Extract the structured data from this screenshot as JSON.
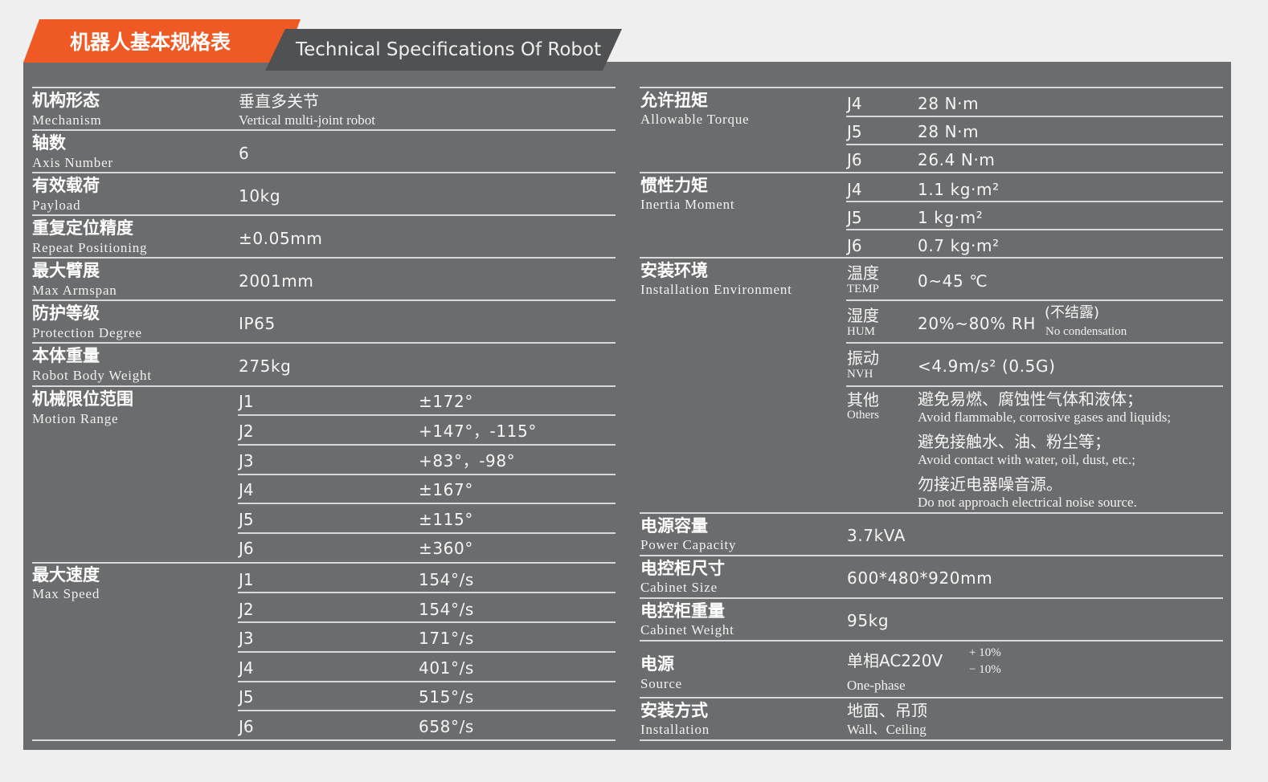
{
  "header": {
    "title_cn": "机器人基本规格表",
    "title_en": "Technical Specifications Of Robot"
  },
  "left": {
    "mechanism": {
      "cn": "机构形态",
      "en": "Mechanism",
      "value_cn": "垂直多关节",
      "value_en": "Vertical multi-joint robot"
    },
    "axis": {
      "cn": "轴数",
      "en": "Axis Number",
      "value": "6"
    },
    "payload": {
      "cn": "有效载荷",
      "en": "Payload",
      "value": "10kg"
    },
    "repeat": {
      "cn": "重复定位精度",
      "en": "Repeat Positioning",
      "value": "±0.05mm"
    },
    "armspan": {
      "cn": "最大臂展",
      "en": "Max Armspan",
      "value": "2001mm"
    },
    "protection": {
      "cn": "防护等级",
      "en": "Protection Degree",
      "value": "IP65"
    },
    "weight": {
      "cn": "本体重量",
      "en": "Robot Body Weight",
      "value": "275kg"
    },
    "motion": {
      "cn": "机械限位范围",
      "en": "Motion Range",
      "rows": [
        {
          "j": "J1",
          "v": "±172°"
        },
        {
          "j": "J2",
          "v": "+147°，-115°"
        },
        {
          "j": "J3",
          "v": "+83°，-98°"
        },
        {
          "j": "J4",
          "v": "±167°"
        },
        {
          "j": "J5",
          "v": "±115°"
        },
        {
          "j": "J6",
          "v": "±360°"
        }
      ]
    },
    "speed": {
      "cn": "最大速度",
      "en": "Max Speed",
      "rows": [
        {
          "j": "J1",
          "v": "154°/s"
        },
        {
          "j": "J2",
          "v": "154°/s"
        },
        {
          "j": "J3",
          "v": "171°/s"
        },
        {
          "j": "J4",
          "v": "401°/s"
        },
        {
          "j": "J5",
          "v": "515°/s"
        },
        {
          "j": "J6",
          "v": "658°/s"
        }
      ]
    }
  },
  "right": {
    "torque": {
      "cn": "允许扭矩",
      "en": "Allowable Torque",
      "rows": [
        {
          "j": "J4",
          "v": "28 N·m"
        },
        {
          "j": "J5",
          "v": "28 N·m"
        },
        {
          "j": "J6",
          "v": "26.4 N·m"
        }
      ]
    },
    "inertia": {
      "cn": "惯性力矩",
      "en": "Inertia Moment",
      "rows": [
        {
          "j": "J4",
          "v": "1.1 kg·m²"
        },
        {
          "j": "J5",
          "v": "1 kg·m²"
        },
        {
          "j": "J6",
          "v": "0.7 kg·m²"
        }
      ]
    },
    "environment": {
      "cn": "安装环境",
      "en": "Installation Environment",
      "temp": {
        "cn": "温度",
        "en": "TEMP",
        "value": "0~45 ℃"
      },
      "hum": {
        "cn": "湿度",
        "en": "HUM",
        "value": "20%~80% RH",
        "note_cn": "(不结露)",
        "note_en": "No condensation"
      },
      "nvh": {
        "cn": "振动",
        "en": "NVH",
        "value": "<4.9m/s² (0.5G)"
      },
      "others": {
        "cn": "其他",
        "en": "Others",
        "lines": [
          {
            "cn": "避免易燃、腐蚀性气体和液体；",
            "en": "Avoid flammable, corrosive gases and liquids;"
          },
          {
            "cn": "避免接触水、油、粉尘等；",
            "en": "Avoid contact with water, oil, dust, etc.;"
          },
          {
            "cn": "勿接近电器噪音源。",
            "en": "Do not approach electrical noise source."
          }
        ]
      }
    },
    "power_capacity": {
      "cn": "电源容量",
      "en": "Power Capacity",
      "value": "3.7kVA"
    },
    "cabinet_size": {
      "cn": "电控柜尺寸",
      "en": "Cabinet Size",
      "value": "600*480*920mm"
    },
    "cabinet_weight": {
      "cn": "电控柜重量",
      "en": "Cabinet Weight",
      "value": "95kg"
    },
    "source": {
      "cn": "电源",
      "en": "Source",
      "value": "单相AC220V",
      "tol_plus": "+ 10%",
      "tol_minus": "− 10%",
      "phase": "One-phase"
    },
    "installation": {
      "cn": "安装方式",
      "en": "Installation",
      "value_cn": "地面、吊顶",
      "value_en": "Wall、Ceiling"
    }
  }
}
